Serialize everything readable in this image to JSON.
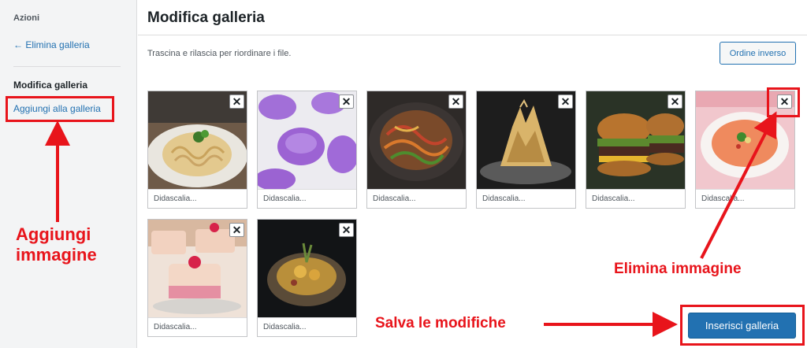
{
  "sidebar": {
    "heading": "Azioni",
    "delete_gallery": "← Elimina galleria",
    "section_title": "Modifica galleria",
    "add_to_gallery": "Aggiungi alla galleria"
  },
  "main": {
    "title": "Modifica galleria",
    "instructions": "Trascina e rilascia per riordinare i file.",
    "reverse_order_button": "Ordine inverso",
    "insert_gallery_button": "Inserisci galleria"
  },
  "gallery": {
    "remove_symbol": "✕",
    "items": [
      {
        "subject": "pasta carbonara",
        "caption_placeholder": "Didascalia..."
      },
      {
        "subject": "purple jellies",
        "caption_placeholder": "Didascalia..."
      },
      {
        "subject": "vegetable noodles",
        "caption_placeholder": "Didascalia..."
      },
      {
        "subject": "filo pastry bundle",
        "caption_placeholder": "Didascalia..."
      },
      {
        "subject": "burgers",
        "caption_placeholder": "Didascalia..."
      },
      {
        "subject": "gazpacho",
        "caption_placeholder": "Didascalia..."
      },
      {
        "subject": "mousse cakes",
        "caption_placeholder": "Didascalia..."
      },
      {
        "subject": "stuffed shell",
        "caption_placeholder": "Didascalia..."
      }
    ]
  },
  "annotations": {
    "add_image": "Aggiungi immagine",
    "add_image_line1": "Aggiungi",
    "add_image_line2": "immagine",
    "delete_image": "Elimina immagine",
    "save_changes": "Salva le modifiche",
    "color": "#e8141b"
  },
  "colors": {
    "primary": "#2271b1",
    "sidebar_bg": "#f3f4f5",
    "annotation": "#e8141b"
  }
}
